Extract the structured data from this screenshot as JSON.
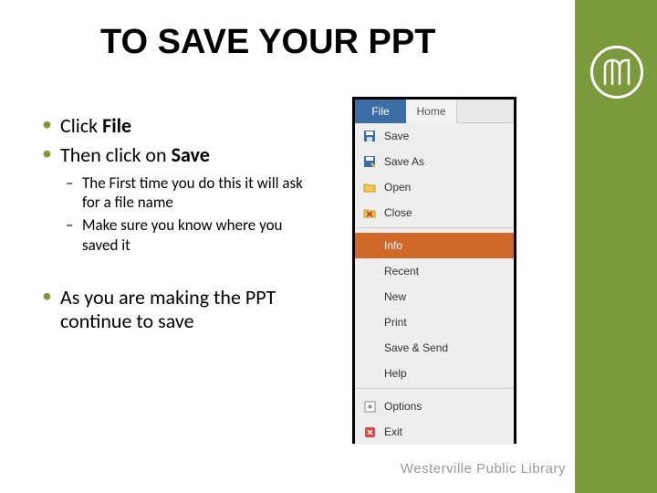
{
  "title": "TO SAVE YOUR PPT",
  "bullets": {
    "b1_pre": "Click ",
    "b1_bold": "File",
    "b2_pre": "Then click on ",
    "b2_bold": "Save",
    "sub1": "The First time you do this it will ask for a file name",
    "sub2": "Make sure you know where you saved it",
    "b3": "As you are making the PPT continue to save"
  },
  "menu": {
    "tab_file": "File",
    "tab_home": "Home",
    "items": {
      "save": "Save",
      "save_as": "Save As",
      "open": "Open",
      "close": "Close",
      "info": "Info",
      "recent": "Recent",
      "new": "New",
      "print": "Print",
      "save_send": "Save & Send",
      "help": "Help",
      "options": "Options",
      "exit": "Exit"
    }
  },
  "footer": "Westerville Public Library"
}
